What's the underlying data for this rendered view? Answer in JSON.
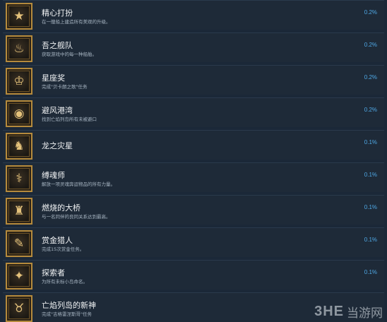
{
  "achievements": [
    {
      "icon": "star-badge-icon",
      "glyph": "★",
      "title": "精心打扮",
      "desc": "在一艘船上建造所有美观的升级。",
      "percent": "0.2%"
    },
    {
      "icon": "flame-helmet-icon",
      "glyph": "♨",
      "title": "吾之舰队",
      "desc": "获取游戏中的每一种船舶。",
      "percent": "0.2%"
    },
    {
      "icon": "celestial-award-icon",
      "glyph": "♔",
      "title": "星座奖",
      "desc": "完成\"贝卡朗之歌\"任务",
      "percent": "0.2%"
    },
    {
      "icon": "globe-icon",
      "glyph": "◉",
      "title": "避风港湾",
      "desc": "找到亡焰列岛所有未被避口",
      "percent": "0.2%"
    },
    {
      "icon": "dragon-icon",
      "glyph": "♞",
      "title": "龙之灾星",
      "desc": "",
      "percent": "0.1%"
    },
    {
      "icon": "caduceus-icon",
      "glyph": "⚕",
      "title": "缚魂师",
      "desc": "解放一项灵魂奔运物品的所有力量。",
      "percent": "0.1%"
    },
    {
      "icon": "burning-bridge-icon",
      "glyph": "♜",
      "title": "燃烧的大桥",
      "desc": "与一名同伴的良同关系达到最高。",
      "percent": "0.1%"
    },
    {
      "icon": "bounty-scroll-icon",
      "glyph": "✎",
      "title": "赏金猎人",
      "desc": "完成15次赏金任务。",
      "percent": "0.1%"
    },
    {
      "icon": "explorer-stars-icon",
      "glyph": "✦",
      "title": "探索者",
      "desc": "为所有未标小岛命名。",
      "percent": "0.1%"
    },
    {
      "icon": "new-god-horns-icon",
      "glyph": "♉",
      "title": "亡焰列岛的新神",
      "desc": "完成\"吉格雷涅斯哥\"任务",
      "percent": ""
    }
  ],
  "watermark": {
    "logo": "3HE",
    "text": "当游网"
  }
}
